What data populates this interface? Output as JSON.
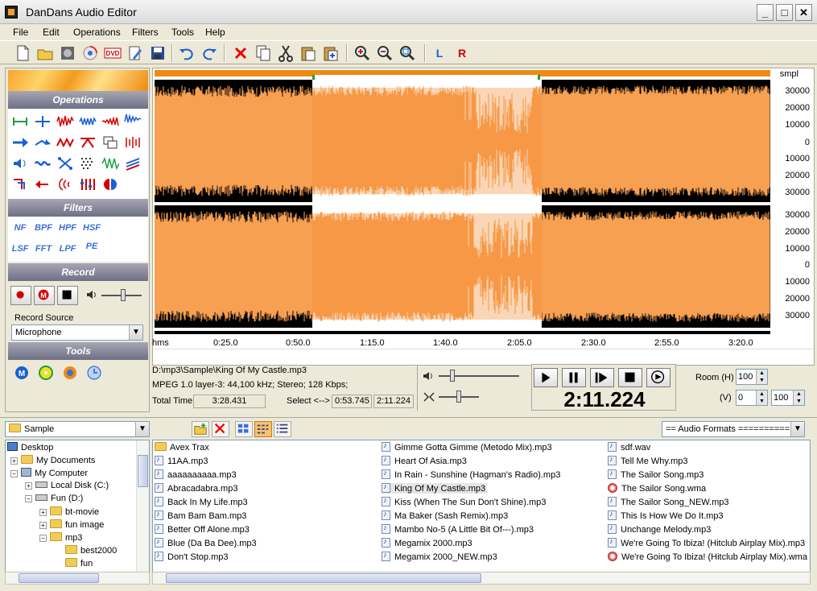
{
  "window": {
    "title": "DanDans Audio Editor",
    "min": "_",
    "max": "□",
    "close": "✕"
  },
  "menu": [
    "File",
    "Edit",
    "Operations",
    "Filters",
    "Tools",
    "Help"
  ],
  "toolbar": {
    "left_label": "L",
    "right_label": "R"
  },
  "left_panel": {
    "operations_title": "Operations",
    "filters_title": "Filters",
    "filters": [
      "NF",
      "BPF",
      "HPF",
      "HSF",
      "LSF",
      "FFT",
      "LPF",
      "PE"
    ],
    "record_title": "Record",
    "record_source_label": "Record Source",
    "record_source_value": "Microphone",
    "tools_title": "Tools"
  },
  "waveform": {
    "unit_label": "smpl",
    "scale_ticks": [
      "30000",
      "20000",
      "10000",
      "0",
      "10000",
      "20000",
      "30000"
    ],
    "time_unit": "hms",
    "time_ticks": [
      "0:25.0",
      "0:50.0",
      "1:15.0",
      "1:40.0",
      "2:05.0",
      "2:30.0",
      "2:55.0",
      "3:20.0"
    ]
  },
  "file_info": {
    "path": "D:\\mp3\\Sample\\King Of My Castle.mp3",
    "format": "MPEG 1.0 layer-3: 44,100 kHz; Stereo; 128 Kbps;",
    "total_time_label": "Total Time",
    "total_time": "3:28.431",
    "select_label": "Select <-->",
    "select_start": "0:53.745",
    "select_end": "2:11.224"
  },
  "transport": {
    "current_time": "2:11.224"
  },
  "room": {
    "h_label": "Room (H)",
    "h_value": "100",
    "v_label": "(V)",
    "v_value1": "0",
    "v_value2": "100"
  },
  "browser": {
    "folder_combo": "Sample",
    "format_combo": "== Audio Formats ==========",
    "tree": [
      {
        "label": "Desktop",
        "level": 0
      },
      {
        "label": "My Documents",
        "level": 1
      },
      {
        "label": "My Computer",
        "level": 1
      },
      {
        "label": "Local Disk (C:)",
        "level": 2
      },
      {
        "label": "Fun (D:)",
        "level": 2
      },
      {
        "label": "bt-movie",
        "level": 3
      },
      {
        "label": "fun image",
        "level": 3
      },
      {
        "label": "mp3",
        "level": 3
      },
      {
        "label": "best2000",
        "level": 4
      },
      {
        "label": "fun",
        "level": 4
      }
    ],
    "files_col1": [
      "Avex Trax",
      "11AA.mp3",
      "aaaaaaaaaa.mp3",
      "Abracadabra.mp3",
      "Back In My Life.mp3",
      "Bam Bam Bam.mp3",
      "Better Off Alone.mp3",
      "Blue (Da Ba Dee).mp3",
      "Don't Stop.mp3"
    ],
    "files_col2": [
      "Gimme Gotta Gimme (Metodo Mix).mp3",
      "Heart Of Asia.mp3",
      "In Rain - Sunshine (Hagman's Radio).mp3",
      "King Of My Castle.mp3",
      "Kiss (When The Sun Don't Shine).mp3",
      "Ma Baker (Sash Remix).mp3",
      "Mambo No-5 (A Little Bit Of---).mp3",
      "Megamix 2000.mp3",
      "Megamix 2000_NEW.mp3"
    ],
    "files_col3": [
      "sdf.wav",
      "Tell Me Why.mp3",
      "The Sailor Song.mp3",
      "The Sailor Song.wma",
      "The Sailor Song_NEW.mp3",
      "This Is How We Do It.mp3",
      "Unchange Melody.mp3",
      "We're Going To Ibiza! (Hitclub Airplay Mix).mp3",
      "We're Going To Ibiza! (Hitclub Airplay Mix).wma"
    ]
  },
  "colors": {
    "wave": "#f7a052",
    "selection": "#f38a2e",
    "accent_red": "#d40000",
    "accent_blue": "#1a5fd4"
  }
}
